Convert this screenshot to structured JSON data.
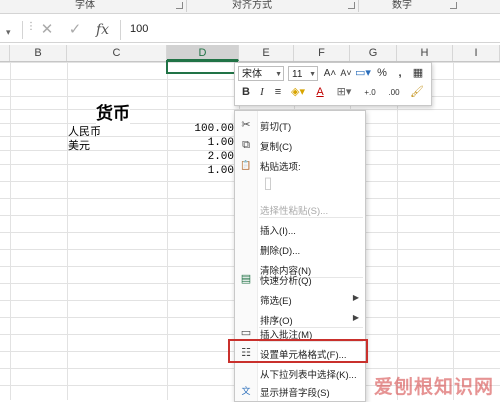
{
  "ribbon": {
    "groups": [
      "字体",
      "对齐方式",
      "数字"
    ]
  },
  "formula_bar": {
    "name_box_arrow": "▾",
    "dots": "⋮",
    "cancel_glyph": "✕",
    "enter_glyph": "✓",
    "fx_label": "fx",
    "value": "100"
  },
  "columns": [
    "B",
    "C",
    "D",
    "E",
    "F",
    "G",
    "H",
    "I"
  ],
  "selected_column": "D",
  "cells": {
    "title": "货币",
    "rmb": "人民币",
    "usd": "美元",
    "d1": "100.00",
    "d2": "1.00",
    "d3": "2.00",
    "d4": "1.00"
  },
  "mini_toolbar": {
    "font_name": "宋体",
    "font_size": "11",
    "grow": "A˄",
    "shrink": "A˅",
    "percent": "%",
    "comma": ",",
    "bold": "B",
    "italic": "I",
    "align": "≡",
    "font_color": "A",
    "inc_decimal": "+.0",
    "dec_decimal": ".00"
  },
  "context_menu": {
    "items": [
      {
        "label": "剪切(T)",
        "icon": "scissors-icon",
        "glyph": "✂"
      },
      {
        "label": "复制(C)",
        "icon": "copy-icon",
        "glyph": "⧉"
      },
      {
        "label": "粘贴选项:",
        "icon": "paste-icon",
        "glyph": "📋"
      },
      {
        "label": "选择性粘贴(S)...",
        "disabled": true
      },
      {
        "label": "插入(I)..."
      },
      {
        "label": "删除(D)..."
      },
      {
        "label": "清除内容(N)"
      },
      {
        "label": "快速分析(Q)",
        "icon": "quick-analysis-icon",
        "glyph": "▤"
      },
      {
        "label": "筛选(E)",
        "submenu": true
      },
      {
        "label": "排序(O)",
        "submenu": true
      },
      {
        "label": "插入批注(M)",
        "icon": "comment-icon",
        "glyph": "▭"
      },
      {
        "label": "设置单元格格式(F)...",
        "icon": "format-cells-icon",
        "glyph": "☷",
        "highlighted": true
      },
      {
        "label": "从下拉列表中选择(K)..."
      },
      {
        "label": "显示拼音字段(S)",
        "icon": "phonetic-icon",
        "glyph": "文"
      }
    ],
    "submenu_arrow": "▶"
  },
  "watermark": "爱刨根知识网",
  "colors": {
    "accent": "#217346",
    "highlight": "#c9302c"
  }
}
